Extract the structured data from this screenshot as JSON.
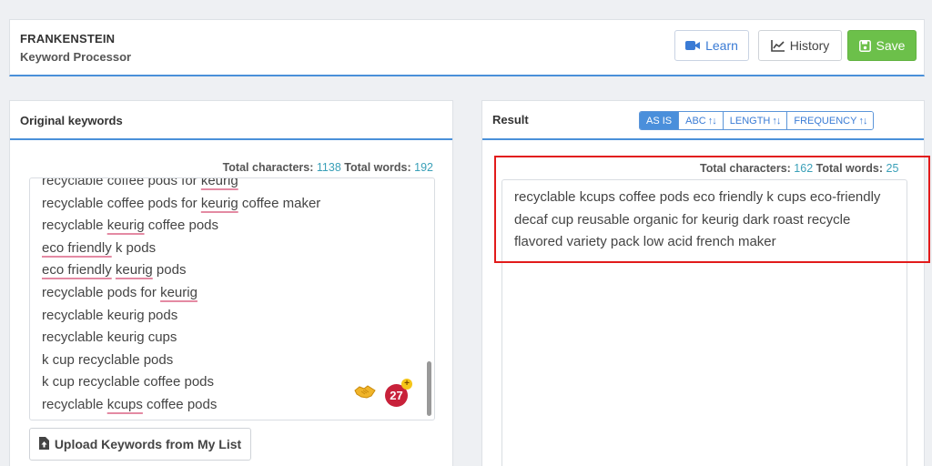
{
  "app": {
    "title": "FRANKENSTEIN",
    "subtitle": "Keyword Processor"
  },
  "toolbar": {
    "learn_label": "Learn",
    "history_label": "History",
    "save_label": "Save"
  },
  "left_panel": {
    "title": "Original keywords",
    "stats": {
      "chars_label": "Total characters:",
      "chars_value": "1138",
      "words_label": "Total words:",
      "words_value": "192"
    },
    "keywords": [
      {
        "parts": [
          {
            "t": "recyclable coffee pods for "
          },
          {
            "t": "keurig",
            "u": true
          }
        ]
      },
      {
        "parts": [
          {
            "t": "recyclable coffee pods for "
          },
          {
            "t": "keurig",
            "u": true
          },
          {
            "t": " coffee maker"
          }
        ]
      },
      {
        "parts": [
          {
            "t": "recyclable "
          },
          {
            "t": "keurig",
            "u": true
          },
          {
            "t": " coffee pods"
          }
        ]
      },
      {
        "parts": [
          {
            "t": "eco friendly",
            "u": true
          },
          {
            "t": " k pods"
          }
        ]
      },
      {
        "parts": [
          {
            "t": "eco friendly",
            "u": true
          },
          {
            "t": " "
          },
          {
            "t": "keurig",
            "u": true
          },
          {
            "t": " pods"
          }
        ]
      },
      {
        "parts": [
          {
            "t": "recyclable pods for "
          },
          {
            "t": "keurig",
            "u": true
          }
        ]
      },
      {
        "parts": [
          {
            "t": "recyclable keurig pods"
          }
        ]
      },
      {
        "parts": [
          {
            "t": "recyclable keurig cups"
          }
        ]
      },
      {
        "parts": [
          {
            "t": "k cup recyclable pods"
          }
        ]
      },
      {
        "parts": [
          {
            "t": "k cup recyclable coffee pods"
          }
        ]
      },
      {
        "parts": [
          {
            "t": "recyclable "
          },
          {
            "t": "kcups",
            "u": true
          },
          {
            "t": " coffee pods"
          }
        ]
      }
    ],
    "badge_count": "27",
    "badge_plus": "+",
    "upload_label": "Upload Keywords from My List"
  },
  "right_panel": {
    "title": "Result",
    "sort_options": [
      {
        "label": "AS IS",
        "arrows": "",
        "active": true
      },
      {
        "label": "ABC",
        "arrows": "↑↓",
        "active": false
      },
      {
        "label": "LENGTH",
        "arrows": "↑↓",
        "active": false
      },
      {
        "label": "FREQUENCY",
        "arrows": "↑↓",
        "active": false
      }
    ],
    "stats": {
      "chars_label": "Total characters:",
      "chars_value": "162",
      "words_label": "Total words:",
      "words_value": "25"
    },
    "result_text": "recyclable kcups coffee pods eco friendly k cups eco-friendly decaf cup reusable organic for keurig dark roast recycle flavored variety pack low acid french maker"
  },
  "colors": {
    "accent_blue": "#4a90d9",
    "save_green": "#6cc04a",
    "highlight_red": "#e21b1b",
    "stat_number": "#3aa0b8",
    "underline_pink": "#e48aa3"
  },
  "icons": [
    "video-camera-icon",
    "line-chart-icon",
    "floppy-disk-icon",
    "file-upload-icon",
    "handshake-icon",
    "sort-arrows-icon"
  ]
}
